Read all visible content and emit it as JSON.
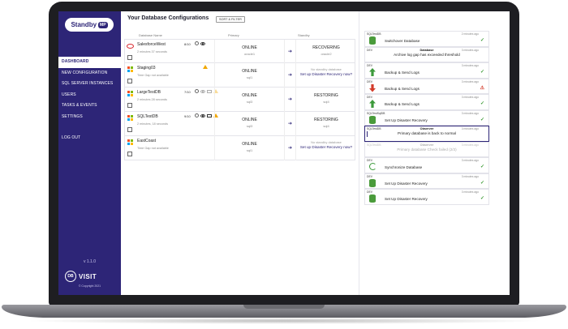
{
  "brand": {
    "name": "Standby",
    "badge": "MP"
  },
  "sidebar": {
    "items": [
      {
        "label": "DASHBOARD",
        "active": true
      },
      {
        "label": "NEW CONFIGURATION",
        "active": false
      },
      {
        "label": "SQL SERVER INSTANCES",
        "active": false
      },
      {
        "label": "USERS",
        "active": false
      },
      {
        "label": "TASKS & EVENTS",
        "active": false
      },
      {
        "label": "SETTINGS",
        "active": false
      }
    ],
    "logout": "LOG OUT",
    "version": "v 1.1.0",
    "company_mark": "DB",
    "company": "VISIT",
    "copyright": "© Copyright 2021"
  },
  "main": {
    "title": "Your Database Configurations",
    "sort_filter": "SORT & FILTER",
    "columns": {
      "database_name": "Database Name",
      "primary": "Primary",
      "standby": "Standby"
    }
  },
  "rows": [
    {
      "name": "SalesforceWest",
      "sub": "2 minutes 37 seconds",
      "count": "8/10",
      "primary_status": "ONLINE",
      "primary_host": "oracle1",
      "standby_status": "RECOVERING",
      "standby_host": "oracle2",
      "standby_none": "",
      "standby_link": ""
    },
    {
      "name": "Staging03",
      "sub": "Time Gap not available",
      "count": "",
      "primary_status": "ONLINE",
      "primary_host": "sql1",
      "standby_status": "",
      "standby_host": "",
      "standby_none": "No standby database",
      "standby_link": "Set up Disaster Recovery now?"
    },
    {
      "name": "LargeTestDB",
      "sub": "2 minutes 28 seconds",
      "count": "7/10",
      "primary_status": "ONLINE",
      "primary_host": "sql3",
      "standby_status": "RESTORING",
      "standby_host": "sql4",
      "standby_none": "",
      "standby_link": ""
    },
    {
      "name": "SQLTestDB",
      "sub": "2 minutes, 18 seconds",
      "count": "9/10",
      "primary_status": "ONLINE",
      "primary_host": "sql3",
      "standby_status": "RESTORING",
      "standby_host": "sql4",
      "standby_none": "",
      "standby_link": ""
    },
    {
      "name": "EastCoast",
      "sub": "Time Gap not available",
      "count": "",
      "primary_status": "ONLINE",
      "primary_host": "sql1",
      "standby_status": "",
      "standby_host": "",
      "standby_none": "No standby database",
      "standby_link": "Set up Disaster Recovery now?"
    }
  ],
  "feed": [
    {
      "env": "SQLTestDB",
      "time": "2 minutes ago",
      "text": "Switchover Database",
      "status": "✓"
    },
    {
      "env": "DEV",
      "time": "3 minutes ago",
      "title": "Database",
      "text": "Archive log gap has exceeded threshold"
    },
    {
      "env": "DEV",
      "time": "3 minutes ago",
      "text": "Backup & Send Logs",
      "status": "✓"
    },
    {
      "env": "DEV",
      "time": "3 minutes ago",
      "text": "Backup & Send Logs",
      "status": "⚠"
    },
    {
      "env": "DEV",
      "time": "3 minutes ago",
      "text": "Backup & Send Logs",
      "status": "✓"
    },
    {
      "env": "SQLTestSqlDB",
      "time": "3 minutes ago",
      "text": "Set Up Disaster Recovery",
      "status": "✓"
    },
    {
      "env": "SQLTestDB",
      "time": "3 minutes ago",
      "title": "Observer",
      "text": "Primary database is back to normal"
    },
    {
      "env": "SQLTestDB",
      "time": "3 minutes ago",
      "title": "Observer",
      "text": "Primary database Check failed (2/3)"
    },
    {
      "env": "DEV",
      "time": "3 minutes ago",
      "text": "Synchronize Database",
      "status": "✓"
    },
    {
      "env": "DEV",
      "time": "3 minutes ago",
      "text": "Set Up Disaster Recovery",
      "status": "✓"
    },
    {
      "env": "DEV",
      "time": "3 minutes ago",
      "text": "Set Up Disaster Recovery",
      "status": "✓"
    }
  ],
  "colors": {
    "brand": "#2d2577",
    "ok": "#3a9a33",
    "error": "#d33b2a",
    "warning": "#f1a700",
    "oracle": "#d9262c"
  }
}
